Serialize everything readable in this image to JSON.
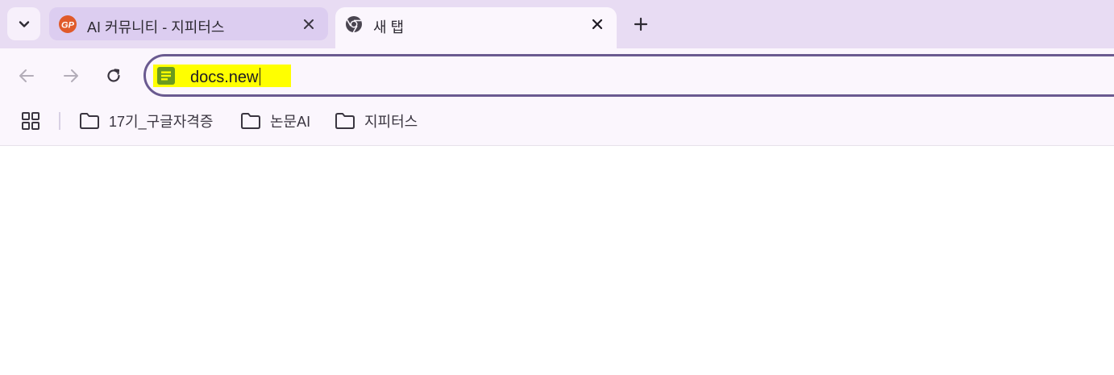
{
  "colors": {
    "tabstrip_bg": "#e8dcf3",
    "active_tab_bg": "#fbf6fd",
    "inactive_tab_bg": "#dccdf0",
    "omnibox_border": "#6a5a90",
    "highlight": "#ffff00",
    "docs_icon_green": "#6b9a1f"
  },
  "tabs": [
    {
      "title": "AI 커뮤니티 - 지피터스",
      "icon": "gpters-logo-icon",
      "active": false
    },
    {
      "title": "새 탭",
      "icon": "chrome-icon",
      "active": true
    }
  ],
  "omnibox": {
    "value": "docs.new",
    "icon": "google-docs-icon"
  },
  "bookmarks": {
    "items": [
      {
        "label": "17기_구글자격증",
        "icon": "folder-icon"
      },
      {
        "label": "논문AI",
        "icon": "folder-icon"
      },
      {
        "label": "지피터스",
        "icon": "folder-icon"
      }
    ]
  }
}
